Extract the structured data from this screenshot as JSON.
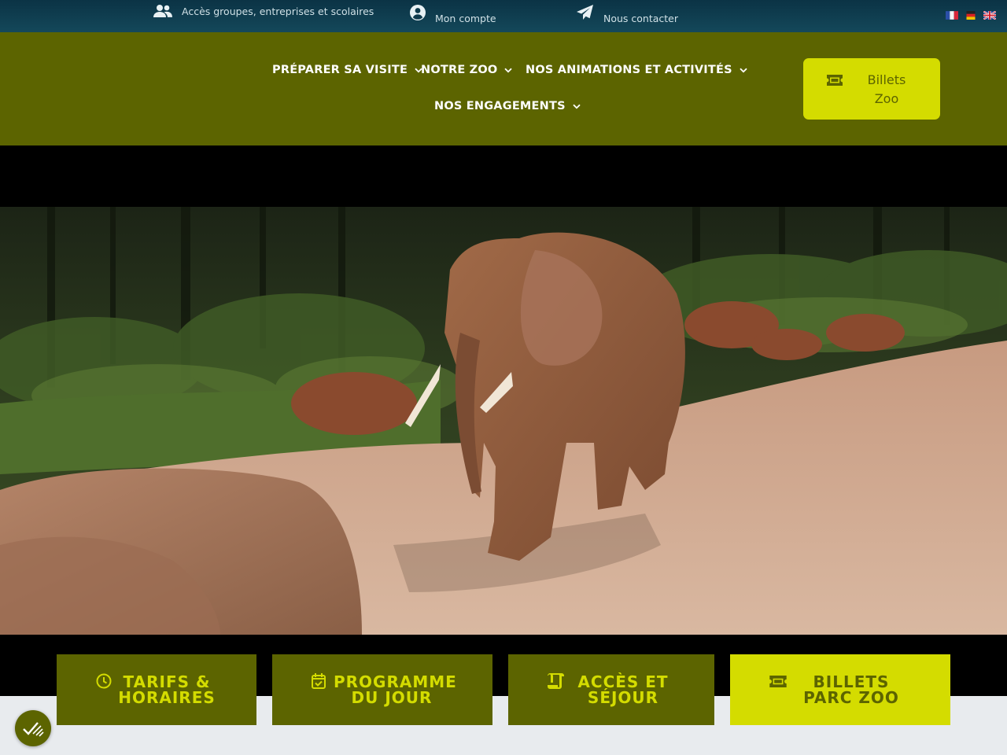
{
  "topbar": {
    "groups_label": "Accès groupes, entreprises et scolaires",
    "account_label": "Mon compte",
    "contact_label": "Nous contacter",
    "languages": [
      "Français",
      "Deutsch",
      "English"
    ]
  },
  "nav": {
    "items": [
      {
        "label": "PRÉPARER SA VISITE"
      },
      {
        "label": "NOTRE ZOO"
      },
      {
        "label": "NOS ANIMATIONS ET ACTIVITÉS"
      },
      {
        "label": "NOS ENGAGEMENTS"
      }
    ],
    "cta": {
      "line1": "Billets",
      "line2": "Zoo"
    }
  },
  "hero": {
    "image_alt": "Éléphants d'Afrique dans leur enclos"
  },
  "tiles": [
    {
      "line1": "TARIFS &",
      "line2": "HORAIRES",
      "icon": "clock-icon"
    },
    {
      "line1": "PROGRAMME",
      "line2": "DU JOUR",
      "icon": "calendar-check-icon"
    },
    {
      "line1": "ACCÈS ET",
      "line2": "SÉJOUR",
      "icon": "scroll-icon"
    },
    {
      "line1": "BILLETS",
      "line2": "PARC ZOO",
      "icon": "ticket-icon"
    }
  ],
  "colors": {
    "nav_bg": "#5c6400",
    "accent": "#d4dc00",
    "topbar_bg": "#0b3345"
  }
}
